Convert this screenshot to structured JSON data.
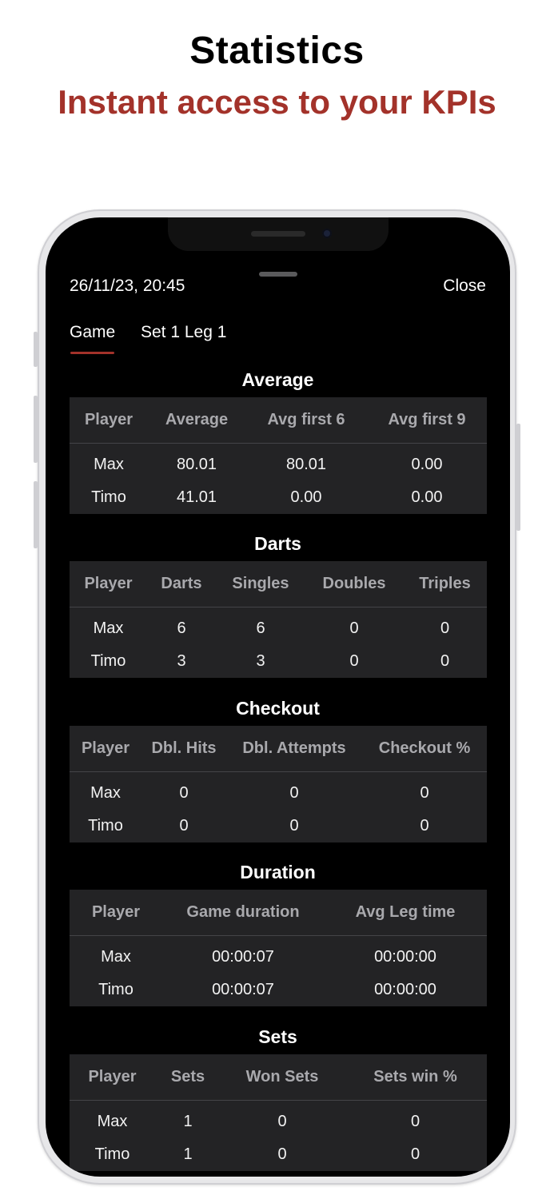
{
  "promo": {
    "title": "Statistics",
    "subtitle": "Instant access to your KPIs"
  },
  "colors": {
    "accent": "#a3322a",
    "screen_bg": "#000000",
    "table_bg": "#232325",
    "header_text": "#a9a9ad"
  },
  "header": {
    "date": "26/11/23, 20:45",
    "close_label": "Close"
  },
  "tabs": [
    {
      "label": "Game",
      "active": true
    },
    {
      "label": "Set 1 Leg 1",
      "active": false
    }
  ],
  "sections": {
    "average": {
      "title": "Average",
      "columns": [
        "Player",
        "Average",
        "Avg first 6",
        "Avg first 9"
      ],
      "rows": [
        [
          "Max",
          "80.01",
          "80.01",
          "0.00"
        ],
        [
          "Timo",
          "41.01",
          "0.00",
          "0.00"
        ]
      ]
    },
    "darts": {
      "title": "Darts",
      "columns": [
        "Player",
        "Darts",
        "Singles",
        "Doubles",
        "Triples"
      ],
      "rows": [
        [
          "Max",
          "6",
          "6",
          "0",
          "0"
        ],
        [
          "Timo",
          "3",
          "3",
          "0",
          "0"
        ]
      ]
    },
    "checkout": {
      "title": "Checkout",
      "columns": [
        "Player",
        "Dbl. Hits",
        "Dbl. Attempts",
        "Checkout %"
      ],
      "rows": [
        [
          "Max",
          "0",
          "0",
          "0"
        ],
        [
          "Timo",
          "0",
          "0",
          "0"
        ]
      ]
    },
    "duration": {
      "title": "Duration",
      "columns": [
        "Player",
        "Game duration",
        "Avg Leg time"
      ],
      "rows": [
        [
          "Max",
          "00:00:07",
          "00:00:00"
        ],
        [
          "Timo",
          "00:00:07",
          "00:00:00"
        ]
      ]
    },
    "sets": {
      "title": "Sets",
      "columns": [
        "Player",
        "Sets",
        "Won Sets",
        "Sets win %"
      ],
      "rows": [
        [
          "Max",
          "1",
          "0",
          "0"
        ],
        [
          "Timo",
          "1",
          "0",
          "0"
        ]
      ]
    }
  }
}
